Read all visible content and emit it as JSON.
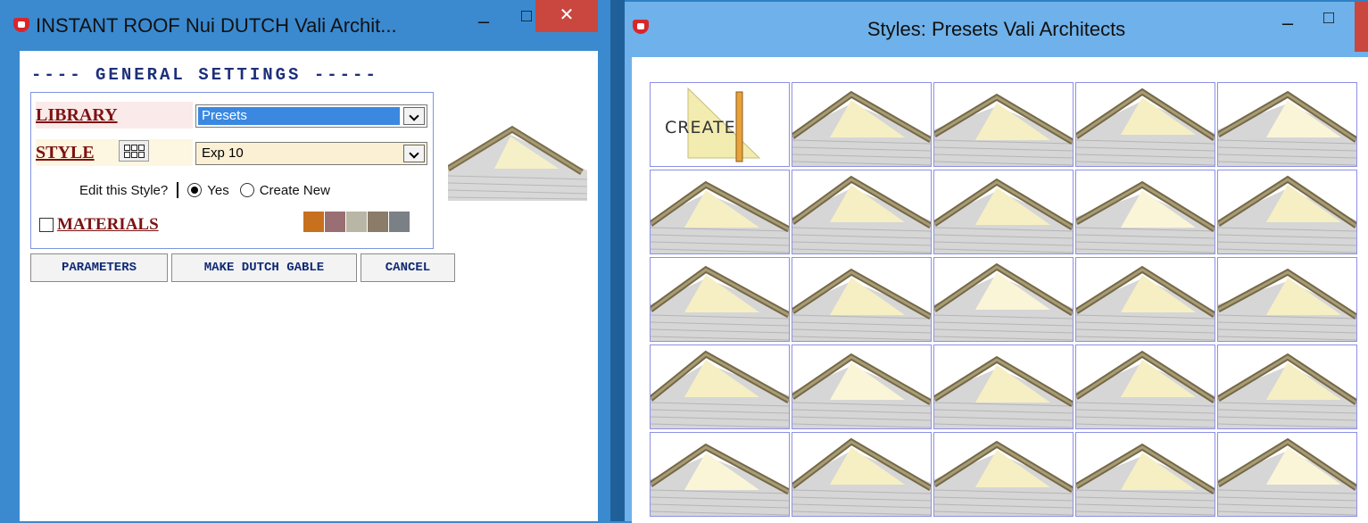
{
  "left_window": {
    "title": "INSTANT ROOF Nui DUTCH   Vali Archit...",
    "minimize": "–",
    "maximize": "□",
    "close": "✕",
    "settings_title": "---- GENERAL  SETTINGS -----",
    "library": {
      "label": "LIBRARY",
      "value": "Presets"
    },
    "style": {
      "label": "STYLE",
      "value": "Exp 10"
    },
    "edit_style": {
      "prompt": "Edit this Style?",
      "yes": "Yes",
      "create_new": "Create New",
      "selected": "yes"
    },
    "materials": {
      "label": "MATERIALS",
      "checked": false,
      "swatches": [
        "#c7701e",
        "#9a6f73",
        "#b9b6a6",
        "#8a7c68",
        "#7b7f86"
      ]
    },
    "buttons": {
      "parameters": "PARAMETERS",
      "make": "MAKE DUTCH GABLE",
      "cancel": "CANCEL"
    }
  },
  "right_window": {
    "title": "Styles: Presets    Vali Architects",
    "minimize": "–",
    "maximize": "□",
    "create_label": "CREATE",
    "gallery": {
      "rows": 5,
      "columns": 5
    }
  }
}
